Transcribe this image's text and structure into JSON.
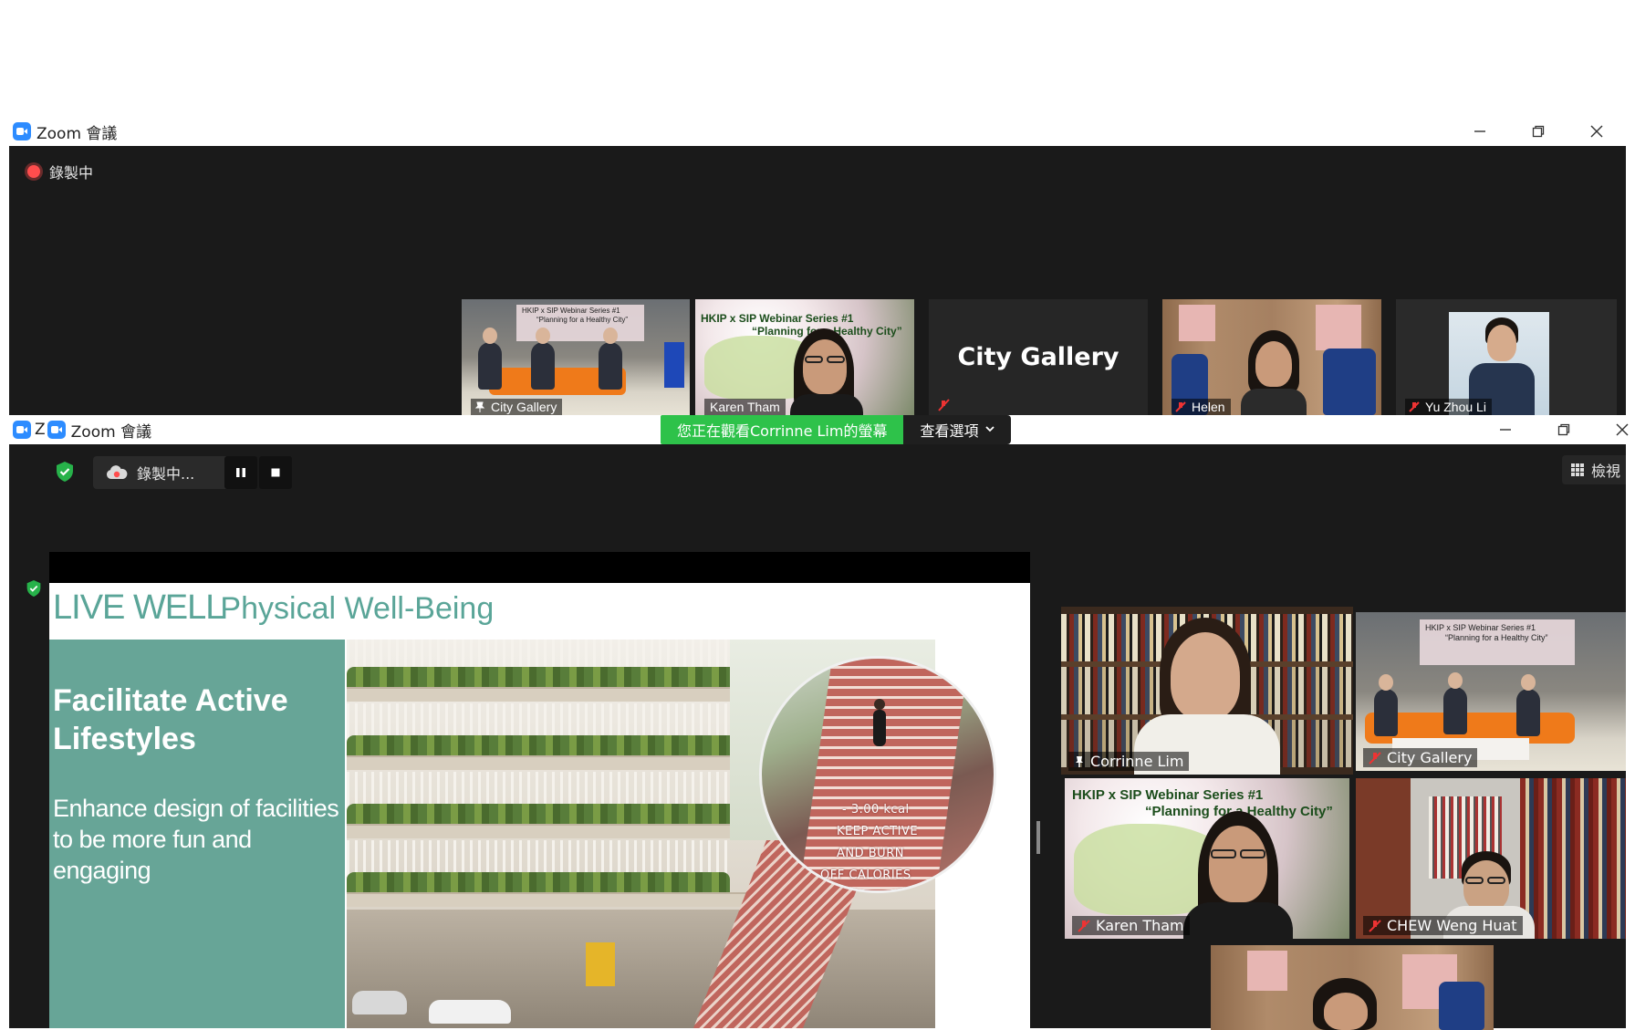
{
  "window1": {
    "title": "Zoom 會議",
    "recording_label": "錄製中",
    "thumbnails": [
      {
        "name": "City Gallery",
        "active": true
      },
      {
        "name": "Karen Tham",
        "active": false,
        "slide_line1": "HKIP x SIP Webinar Series #1",
        "slide_line2": "“Planning for a Healthy City”"
      },
      {
        "name": "City Gallery",
        "active": false
      },
      {
        "name": "Helen",
        "active": false
      },
      {
        "name": "Yu Zhou Li",
        "active": false
      }
    ],
    "room_slide_line1": "HKIP x SIP Webinar Series #1",
    "room_slide_line2": "“Planning for a Healthy City”"
  },
  "window2": {
    "title": "Zoom 會議",
    "title_stub": "Z",
    "viewing_banner": "您正在觀看Corrinne  Lim的螢幕",
    "view_options": "查看選項",
    "recording_label": "錄製中...",
    "view_button": "檢視",
    "slide": {
      "title": "LIVE WELL",
      "subtitle": "Physical Well-Being",
      "heading_line1": "Facilitate Active",
      "heading_line2": "Lifestyles",
      "body_line1": "Enhance design of facilities",
      "body_line2": "to be more fun and engaging",
      "stair_text": [
        "- 3.00 kcal",
        "KEEP ACTIVE",
        "AND BURN",
        "OFF CALORIES"
      ]
    },
    "gallery": [
      {
        "name": "Corrinne Lim",
        "active": true,
        "muted": false
      },
      {
        "name": "City Gallery",
        "active": false,
        "muted": true
      },
      {
        "name": "Karen Tham",
        "active": false,
        "muted": true
      },
      {
        "name": "CHEW Weng Huat",
        "active": false,
        "muted": true
      },
      {
        "name": "",
        "active": false,
        "muted": false
      }
    ]
  },
  "colors": {
    "active_border": "#b6e05a",
    "banner_green": "#2ec24a",
    "slide_teal": "#67a597",
    "zoom_blue": "#2d8cff",
    "record_red": "#ff4d4d"
  }
}
